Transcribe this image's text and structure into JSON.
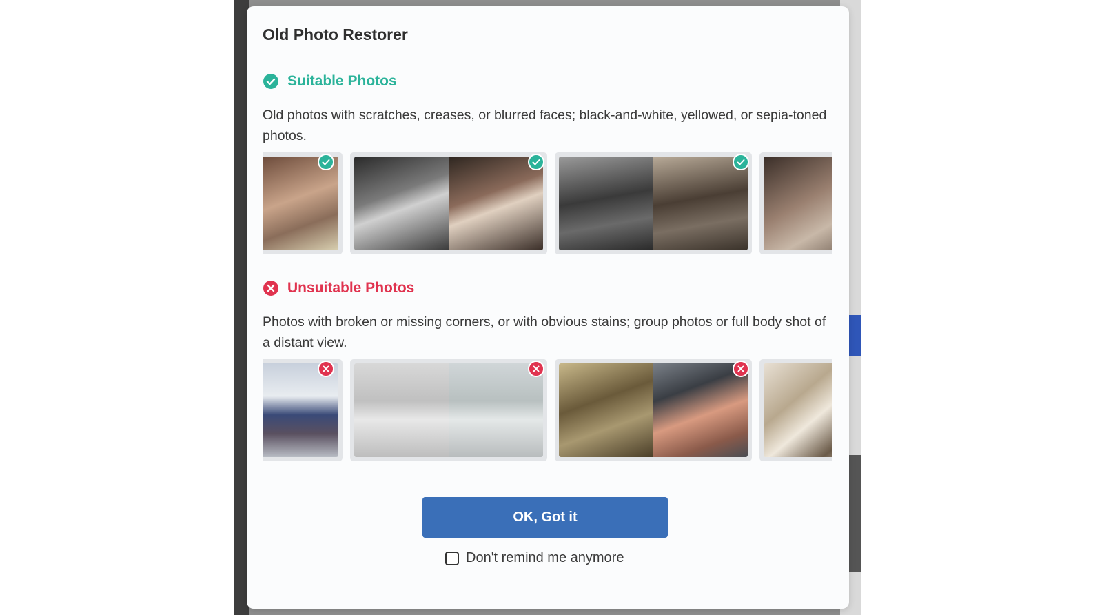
{
  "dialog": {
    "title": "Old Photo Restorer",
    "suitable": {
      "heading": "Suitable Photos",
      "description": "Old photos with scratches, creases, or blurred faces; black-and-white, yellowed, or sepia-toned photos.",
      "color": "#2bb39a",
      "icon": "check-circle-icon"
    },
    "unsuitable": {
      "heading": "Unsuitable Photos",
      "description": "Photos with broken or missing corners, or with obvious stains; group photos or full body shot of a distant view.",
      "color": "#e0334f",
      "icon": "x-circle-icon"
    },
    "ok_button": "OK, Got it",
    "remind_checkbox": {
      "label": "Don't remind me anymore",
      "checked": false
    },
    "accent_color": "#3a6fb8"
  }
}
